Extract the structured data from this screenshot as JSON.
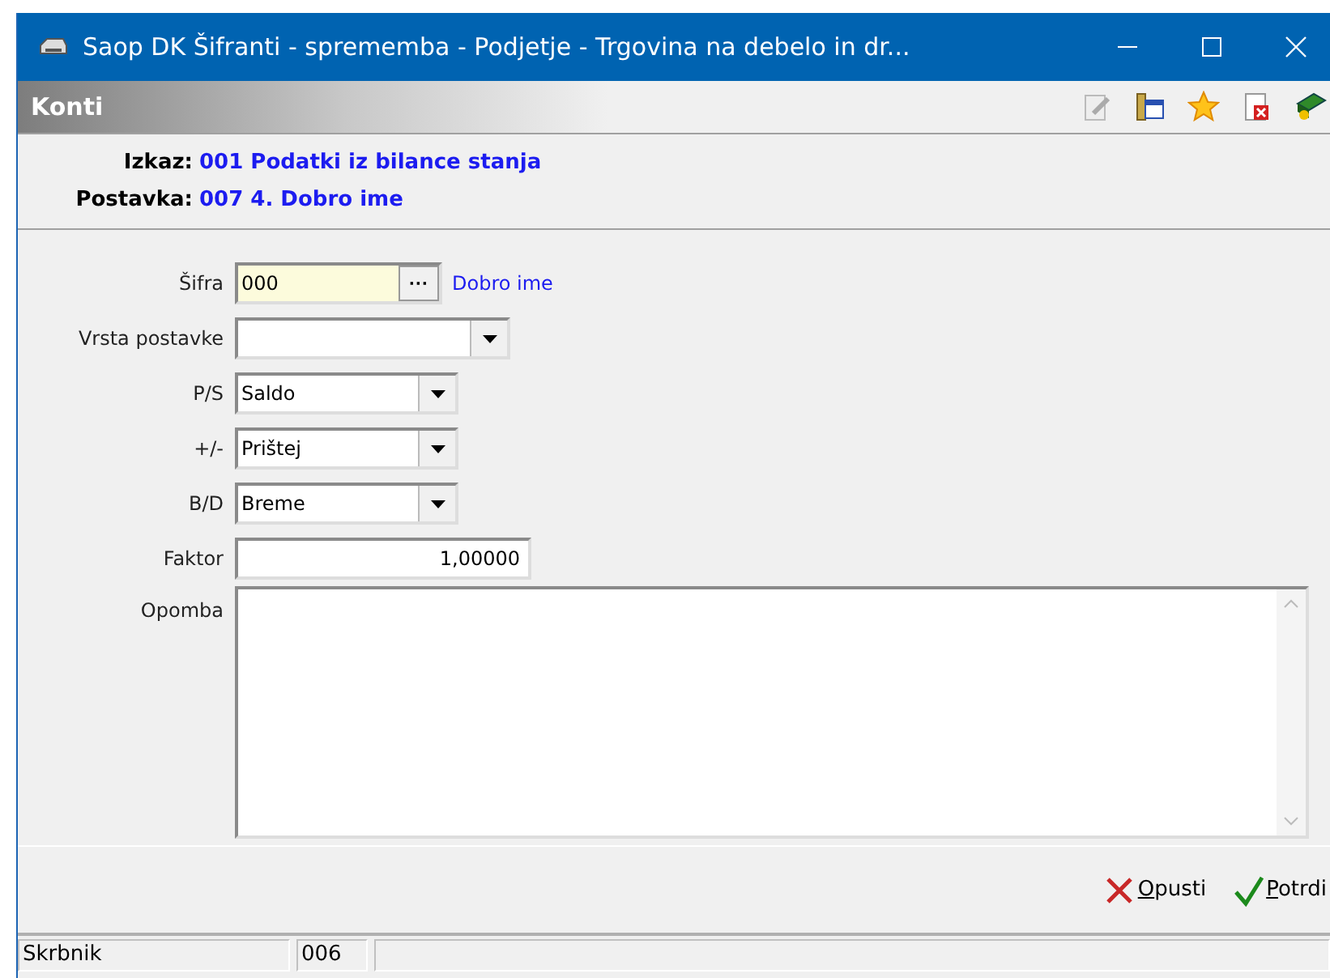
{
  "window": {
    "title": "Saop DK Šifranti - sprememba - Podjetje - Trgovina na debelo in dr..."
  },
  "header": {
    "title": "Konti"
  },
  "info": [
    {
      "label": "Izkaz:",
      "value": "001 Podatki iz bilance stanja"
    },
    {
      "label": "Postavka:",
      "value": "007 4. Dobro ime"
    }
  ],
  "fields": [
    {
      "kind": "lookup",
      "label": "Šifra",
      "value": "000",
      "button": "···",
      "description": "Dobro ime"
    },
    {
      "kind": "combo",
      "label": "Vrsta postavke",
      "wide": true
    },
    {
      "kind": "combo",
      "label": "P/S",
      "value": "Saldo",
      "wide": false
    },
    {
      "kind": "combo",
      "label": "+/-",
      "value": "Prištej",
      "wide": false
    },
    {
      "kind": "combo",
      "label": "B/D",
      "value": "Breme",
      "wide": false
    },
    {
      "kind": "number",
      "label": "Faktor",
      "value": "1,00000"
    },
    {
      "kind": "memo",
      "label": "Opomba"
    }
  ],
  "buttons": [
    {
      "kind": "cancel",
      "label": "Opusti"
    },
    {
      "kind": "confirm",
      "label": "Potrdi"
    }
  ],
  "status_bar": [
    "Skrbnik",
    "006"
  ]
}
